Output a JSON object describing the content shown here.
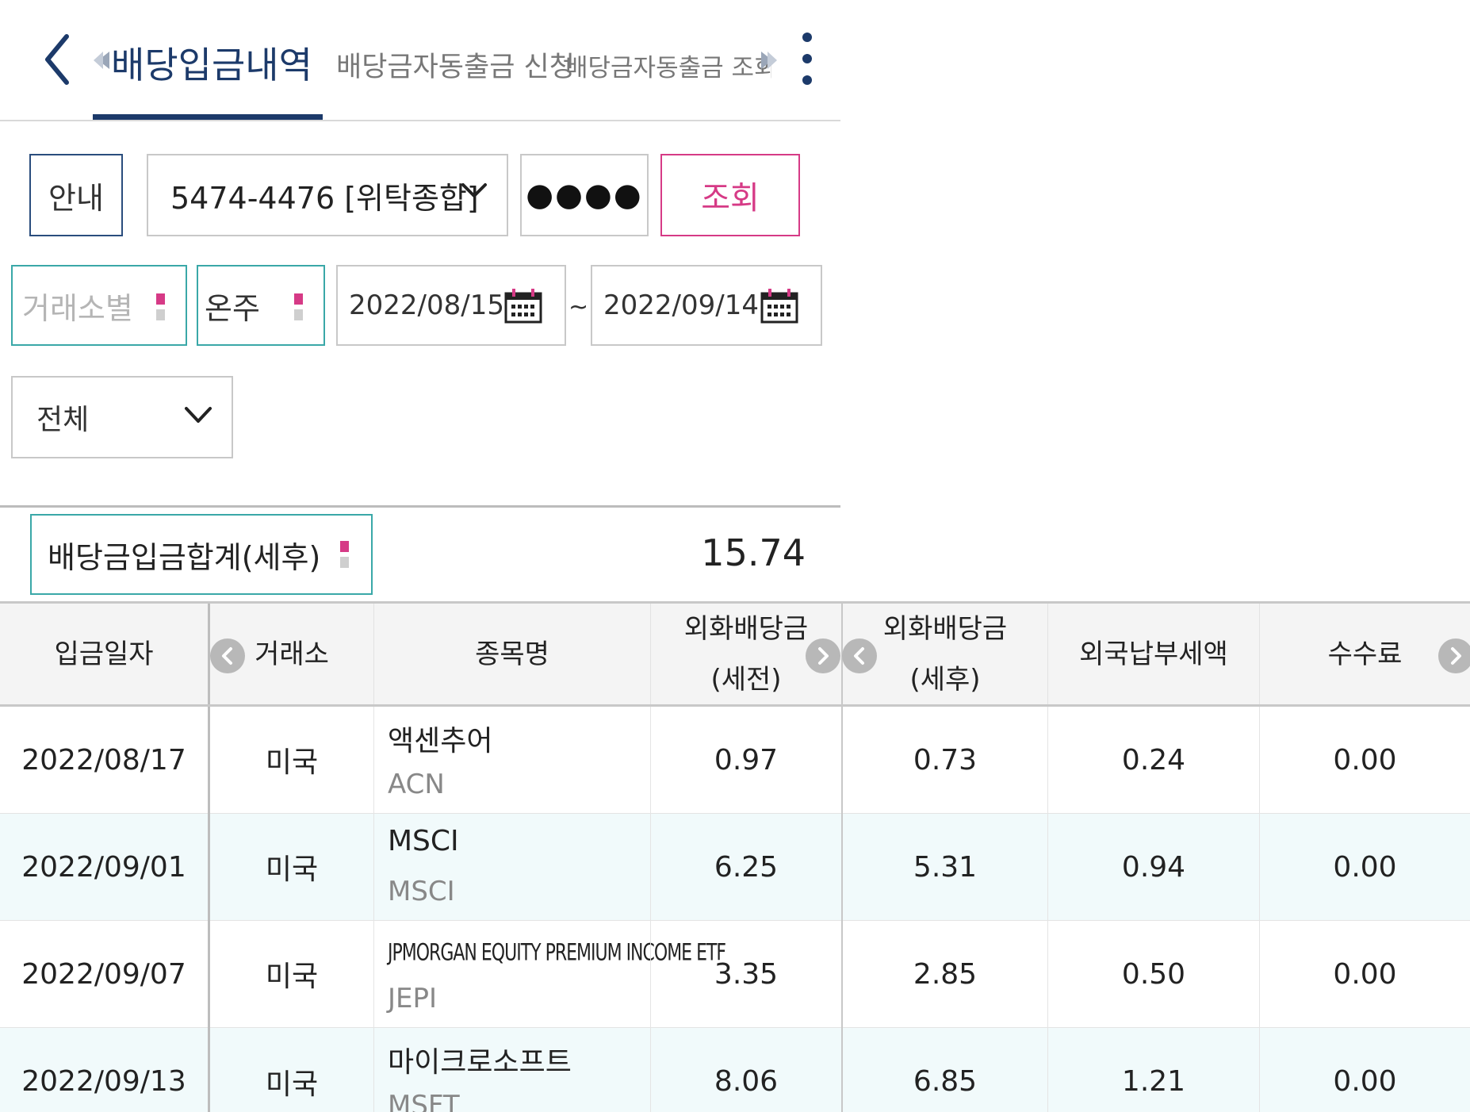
{
  "header": {
    "tabs": [
      {
        "label": "배당입금내역",
        "active": true
      },
      {
        "label": "배당금자동출금 신청",
        "active": false
      },
      {
        "label": "배당금자동출금 조회/해지",
        "active": false
      }
    ]
  },
  "controls": {
    "help_label": "안내",
    "account": "5474-4476 [위탁종합]",
    "password_mask": "●●●●",
    "search_label": "조회",
    "exchange_placeholder": "거래소별",
    "type_value": "온주",
    "date_from": "2022/08/15",
    "date_separator": "~",
    "date_to": "2022/09/14",
    "period_value": "전체"
  },
  "summary": {
    "label": "배당금입금합계(세후)",
    "value": "15.74"
  },
  "table": {
    "headers": {
      "date": "입금일자",
      "exchange": "거래소",
      "name": "종목명",
      "gross_line1": "외화배당금",
      "gross_line2": "(세전)",
      "net_line1": "외화배당금",
      "net_line2": "(세후)",
      "tax": "외국납부세액",
      "fee": "수수료"
    },
    "rows": [
      {
        "date": "2022/08/17",
        "exchange": "미국",
        "name": "액센추어",
        "ticker": "ACN",
        "gross": "0.97",
        "net": "0.73",
        "tax": "0.24",
        "fee": "0.00"
      },
      {
        "date": "2022/09/01",
        "exchange": "미국",
        "name": "MSCI",
        "ticker": "MSCI",
        "gross": "6.25",
        "net": "5.31",
        "tax": "0.94",
        "fee": "0.00"
      },
      {
        "date": "2022/09/07",
        "exchange": "미국",
        "name": "JPMORGAN EQUITY PREMIUM INCOME ETF",
        "ticker": "JEPI",
        "gross": "3.35",
        "net": "2.85",
        "tax": "0.50",
        "fee": "0.00"
      },
      {
        "date": "2022/09/13",
        "exchange": "미국",
        "name": "마이크로소프트",
        "ticker": "MSFT",
        "gross": "8.06",
        "net": "6.85",
        "tax": "1.21",
        "fee": "0.00"
      }
    ]
  },
  "colors": {
    "navy": "#1c3a6a",
    "pink": "#d63a86",
    "teal": "#3aa8a8",
    "row_alt": "#f1fafb"
  },
  "icons": [
    "back-chevron-icon",
    "tab-scroll-left-icon",
    "tab-scroll-right-icon",
    "more-vertical-icon",
    "chevron-down-icon",
    "calendar-icon",
    "column-scroll-left-icon",
    "column-scroll-right-icon"
  ]
}
